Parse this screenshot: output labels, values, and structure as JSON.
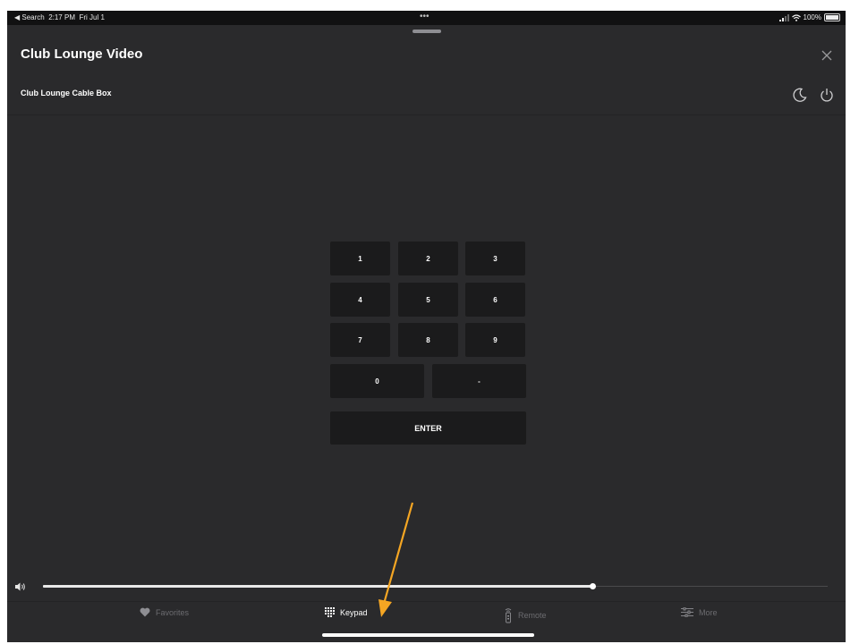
{
  "status_bar": {
    "back_label": "◀ Search",
    "time": "2:17 PM",
    "date": "Fri Jul 1",
    "center_dots": "•••",
    "battery": "100%"
  },
  "header": {
    "title": "Club Lounge Video",
    "close_icon": "close-icon"
  },
  "subheader": {
    "device": "Club Lounge Cable Box",
    "sleep_icon": "moon-icon",
    "power_icon": "power-icon"
  },
  "keypad": {
    "keys": [
      "1",
      "2",
      "3",
      "4",
      "5",
      "6",
      "7",
      "8",
      "9",
      "0",
      "-"
    ],
    "enter": "ENTER"
  },
  "volume": {
    "icon": "speaker-icon",
    "level_percent": 70
  },
  "tabs": [
    {
      "label": "Favorites",
      "icon": "heart-icon",
      "active": false
    },
    {
      "label": "Keypad",
      "icon": "keypad-icon",
      "active": true
    },
    {
      "label": "Remote",
      "icon": "remote-icon",
      "active": false
    },
    {
      "label": "More",
      "icon": "sliders-icon",
      "active": false
    }
  ],
  "colors": {
    "background": "#2a2a2c",
    "key": "#1b1b1c",
    "annotation_arrow": "#f5a623"
  }
}
